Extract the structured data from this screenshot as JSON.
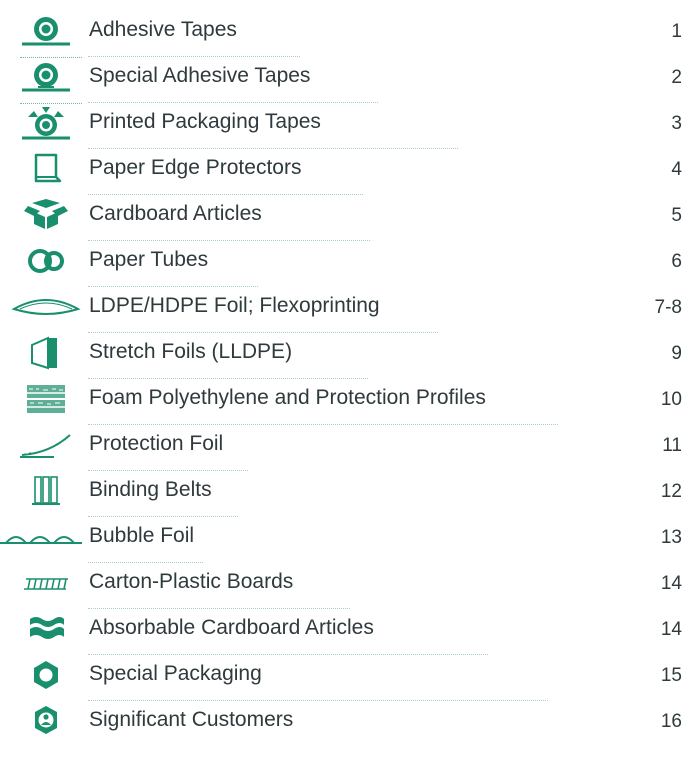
{
  "accent_color": "#1a8f6e",
  "items": [
    {
      "icon": "tape-roll-icon",
      "label": "Adhesive Tapes",
      "page": "1"
    },
    {
      "icon": "special-tape-roll-icon",
      "label": "Special Adhesive Tapes",
      "page": "2"
    },
    {
      "icon": "printed-tape-roll-icon",
      "label": "Printed Packaging Tapes",
      "page": "3"
    },
    {
      "icon": "edge-protector-icon",
      "label": "Paper Edge Protectors",
      "page": "4"
    },
    {
      "icon": "cardboard-box-icon",
      "label": "Cardboard Articles",
      "page": "5"
    },
    {
      "icon": "paper-tubes-icon",
      "label": "Paper Tubes",
      "page": "6"
    },
    {
      "icon": "foil-lens-icon",
      "label": "LDPE/HDPE Foil; Flexoprinting",
      "page": "7-8"
    },
    {
      "icon": "stretch-foil-roll-icon",
      "label": "Stretch Foils (LLDPE)",
      "page": "9"
    },
    {
      "icon": "foam-profile-icon",
      "label": "Foam Polyethylene and Protection Profiles",
      "page": "10"
    },
    {
      "icon": "protection-foil-icon",
      "label": "Protection Foil",
      "page": "11"
    },
    {
      "icon": "binding-belts-icon",
      "label": "Binding Belts",
      "page": "12"
    },
    {
      "icon": "bubble-foil-icon",
      "label": "Bubble Foil",
      "page": "13"
    },
    {
      "icon": "carton-plastic-board-icon",
      "label": "Carton-Plastic Boards",
      "page": "14"
    },
    {
      "icon": "absorbable-cardboard-icon",
      "label": "Absorbable Cardboard Articles",
      "page": "14"
    },
    {
      "icon": "special-packaging-icon",
      "label": "Special Packaging",
      "page": "15"
    },
    {
      "icon": "customers-badge-icon",
      "label": "Significant Customers",
      "page": "16"
    }
  ]
}
